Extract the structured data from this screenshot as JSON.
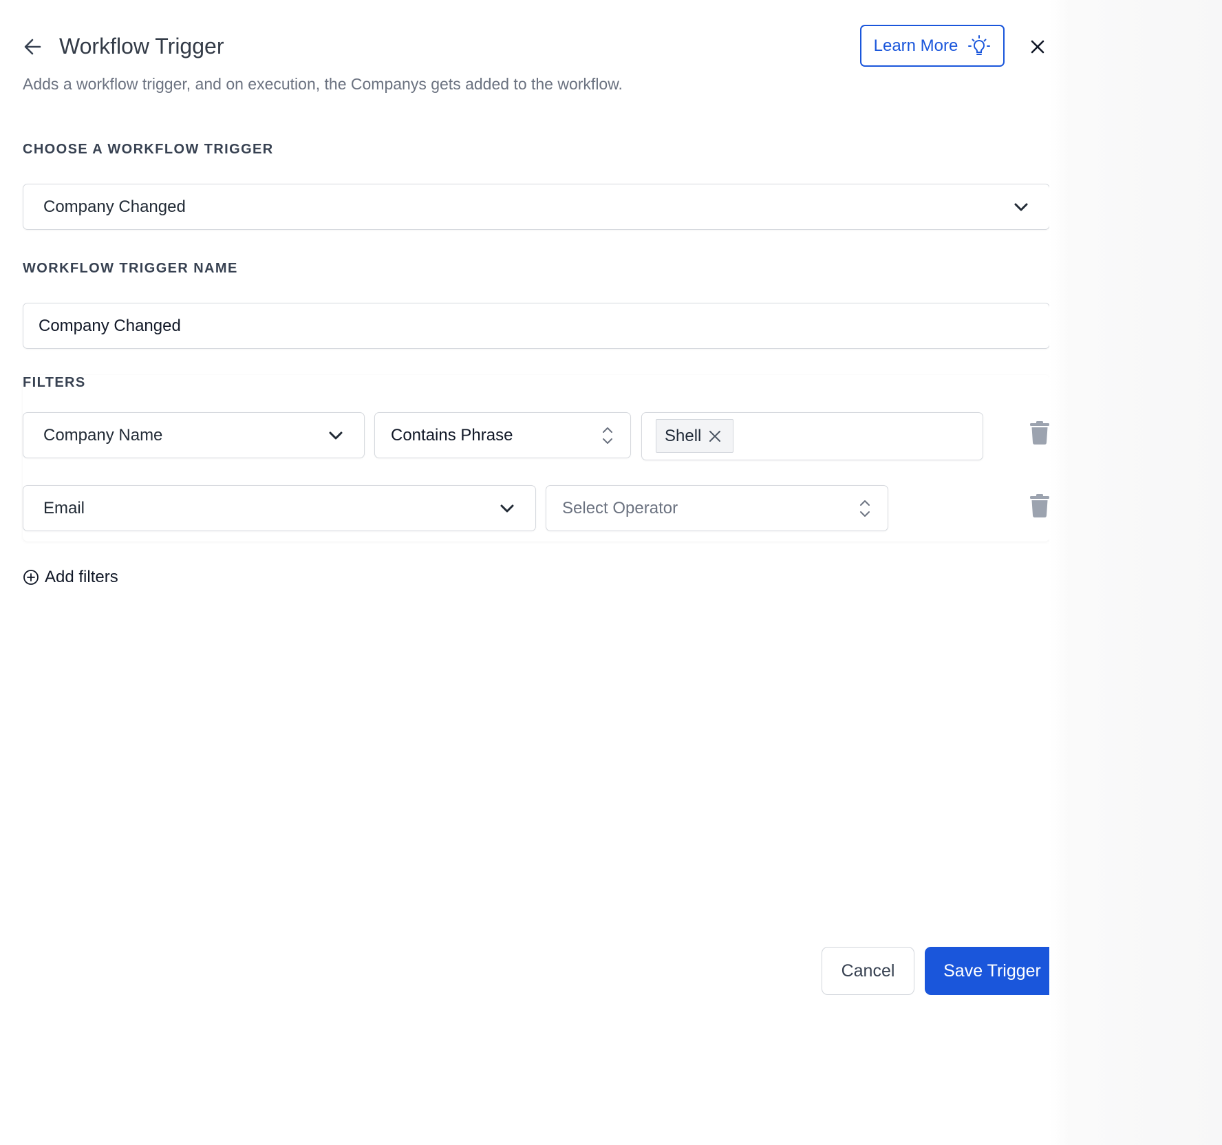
{
  "header": {
    "title": "Workflow Trigger",
    "subtitle": "Adds a workflow trigger, and on execution, the Companys gets added to the workflow.",
    "learn_more_label": "Learn More",
    "back_icon": "arrow-left-icon",
    "close_icon": "close-icon",
    "learn_icon": "lightbulb-icon"
  },
  "trigger_select": {
    "label": "CHOOSE A WORKFLOW TRIGGER",
    "value": "Company Changed"
  },
  "trigger_name": {
    "label": "WORKFLOW TRIGGER NAME",
    "value": "Company Changed"
  },
  "filters": {
    "label": "FILTERS",
    "rows": [
      {
        "field": "Company Name",
        "operator": "Contains Phrase",
        "values": [
          "Shell"
        ]
      },
      {
        "field": "Email",
        "operator_placeholder": "Select Operator"
      }
    ],
    "add_label": "Add filters"
  },
  "footer": {
    "cancel_label": "Cancel",
    "save_label": "Save Trigger"
  },
  "colors": {
    "accent": "#1a56db",
    "text_primary": "#333b47",
    "text_muted": "#6b7280",
    "icon_gray": "#9ca3af"
  }
}
